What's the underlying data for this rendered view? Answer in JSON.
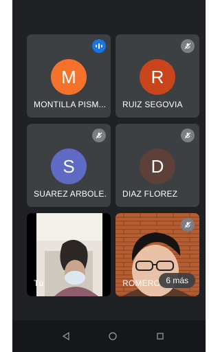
{
  "colors": {
    "background": "#1f2125",
    "tile": "#3c4043",
    "avatar_m": "#f4722b",
    "avatar_r": "#c9441b",
    "avatar_s": "#5f6ac4",
    "avatar_d": "#5d4037",
    "speaking": "#1a73e8"
  },
  "participants": [
    {
      "initial": "M",
      "name": "MONTILLA PISM...",
      "status_icon": "speaking-icon"
    },
    {
      "initial": "R",
      "name": "RUIZ SEGOVIA",
      "status_icon": "mic-off-icon"
    },
    {
      "initial": "S",
      "name": "SUAREZ ARBOLE...",
      "status_icon": "mic-off-icon"
    },
    {
      "initial": "D",
      "name": "DIAZ FLOREZ",
      "status_icon": "mic-off-icon"
    }
  ],
  "video_tiles": [
    {
      "name": "Tú",
      "status_icon": ""
    },
    {
      "name": "ROMERO",
      "status_icon": "mic-off-icon"
    }
  ],
  "more_chip": "6 más",
  "navbar": {
    "back_icon": "back-triangle-icon",
    "home_icon": "home-circle-icon",
    "recents_icon": "recents-square-icon"
  }
}
